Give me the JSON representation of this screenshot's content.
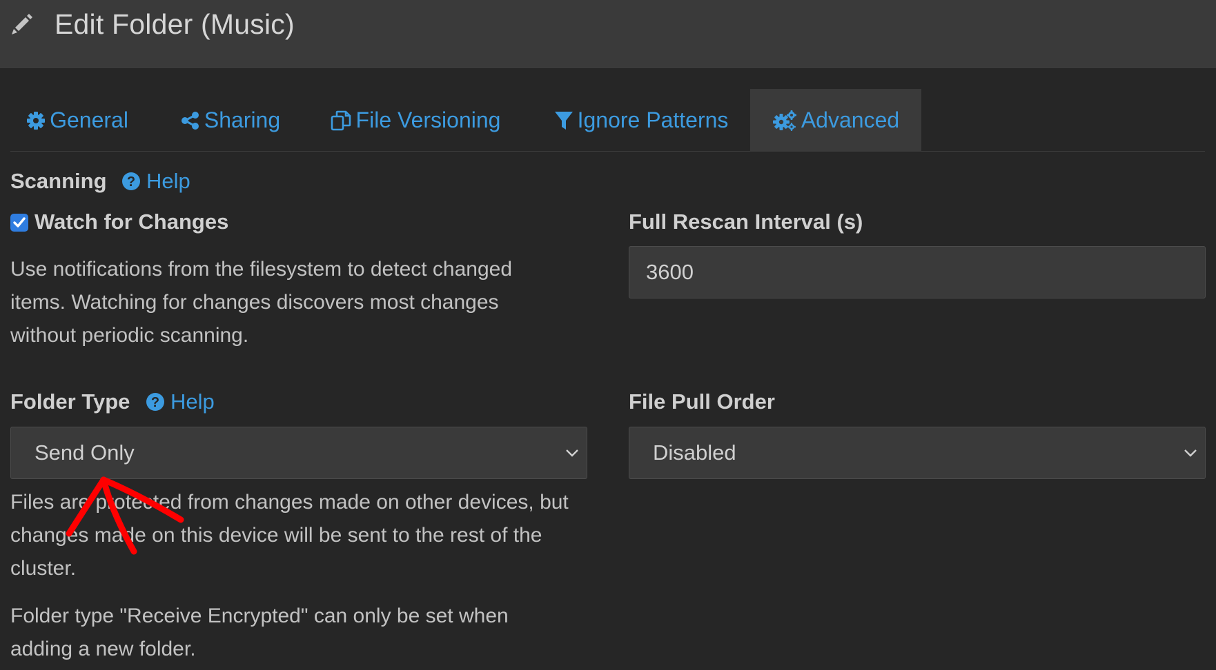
{
  "header": {
    "title": "Edit Folder (Music)",
    "icon": "pencil-icon"
  },
  "tabs": [
    {
      "label": "General",
      "icon": "gear-icon",
      "active": false
    },
    {
      "label": "Sharing",
      "icon": "share-icon",
      "active": false
    },
    {
      "label": "File Versioning",
      "icon": "copy-icon",
      "active": false
    },
    {
      "label": "Ignore Patterns",
      "icon": "filter-icon",
      "active": false
    },
    {
      "label": "Advanced",
      "icon": "gears-icon",
      "active": true
    }
  ],
  "scanning": {
    "heading": "Scanning",
    "help_label": "Help",
    "watch_label": "Watch for Changes",
    "watch_checked": true,
    "watch_description": "Use notifications from the filesystem to detect changed items. Watching for changes discovers most changes without periodic scanning.",
    "rescan_label": "Full Rescan Interval (s)",
    "rescan_value": "3600"
  },
  "folder_type": {
    "heading": "Folder Type",
    "help_label": "Help",
    "selected": "Send Only",
    "description": "Files are protected from changes made on other devices, but changes made on this device will be sent to the rest of the cluster.",
    "note": "Folder type \"Receive Encrypted\" can only be set when adding a new folder."
  },
  "pull_order": {
    "label": "File Pull Order",
    "selected": "Disabled"
  },
  "colors": {
    "background": "#262626",
    "header": "#3a3a3a",
    "link": "#3c9be0",
    "checkbox": "#2f7de0",
    "annotation": "#ff0000"
  }
}
